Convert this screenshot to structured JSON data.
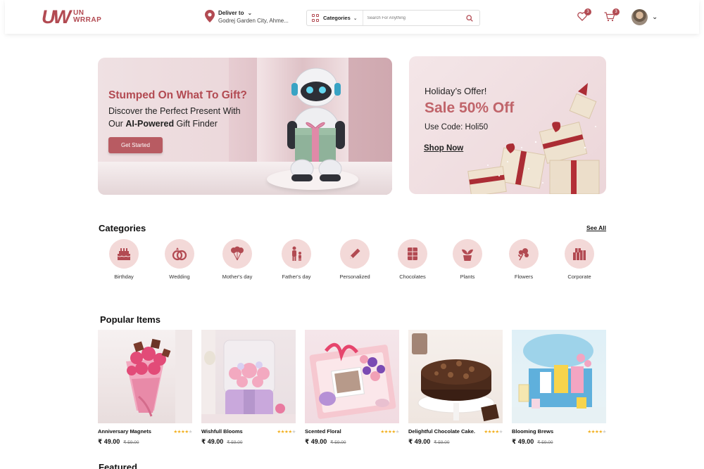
{
  "header": {
    "logo_mark": "UW",
    "logo_line1": "UN",
    "logo_line2": "WRRAP",
    "deliver_label": "Deliver to",
    "deliver_address": "Godrej Garden City, Ahme...",
    "categories_label": "Categories",
    "search_placeholder": "Search For Anything",
    "wishlist_count": "3",
    "cart_count": "3"
  },
  "hero": {
    "title": "Stumped On What To Gift?",
    "line1": "Discover the Perfect Present With",
    "line2_prefix": "Our ",
    "line2_bold": "AI-Powered",
    "line2_suffix": " Gift Finder",
    "cta": "Get Started"
  },
  "offer": {
    "heading": "Holiday’s Offer!",
    "sale": "Sale 50% Off",
    "code": "Use Code: Holi50",
    "cta": "Shop Now"
  },
  "categories": {
    "title": "Categories",
    "see_all": "See All",
    "items": [
      {
        "label": "Birthday",
        "icon": "cake-icon"
      },
      {
        "label": "Wedding",
        "icon": "rings-icon"
      },
      {
        "label": "Mother's day",
        "icon": "balloons-icon"
      },
      {
        "label": "Father's day",
        "icon": "father-child-icon"
      },
      {
        "label": "Personalized",
        "icon": "pencil-icon"
      },
      {
        "label": "Chocolates",
        "icon": "chocolate-icon"
      },
      {
        "label": "Plants",
        "icon": "plant-icon"
      },
      {
        "label": "Flowers",
        "icon": "flower-icon"
      },
      {
        "label": "Corporate",
        "icon": "gift-boxes-icon"
      }
    ]
  },
  "popular": {
    "title": "Popular Items",
    "items": [
      {
        "name": "Anniversary Magnets",
        "price": "₹ 49.00",
        "old_price": "₹ 59.00",
        "rating": 4
      },
      {
        "name": "Wishfull Blooms",
        "price": "₹ 49.00",
        "old_price": "₹ 59.00",
        "rating": 4
      },
      {
        "name": "Scented Floral",
        "price": "₹ 49.00",
        "old_price": "₹ 59.00",
        "rating": 4
      },
      {
        "name": "Delightful Chocolate Cake..",
        "price": "₹ 49.00",
        "old_price": "₹ 59.00",
        "rating": 4
      },
      {
        "name": "Blooming Brews",
        "price": "₹ 49.00",
        "old_price": "₹ 59.00",
        "rating": 4
      }
    ]
  },
  "featured": {
    "title": "Featured"
  },
  "colors": {
    "brand": "#b24a52",
    "category_circle": "#f3d9d8",
    "star": "#f2b01e"
  }
}
